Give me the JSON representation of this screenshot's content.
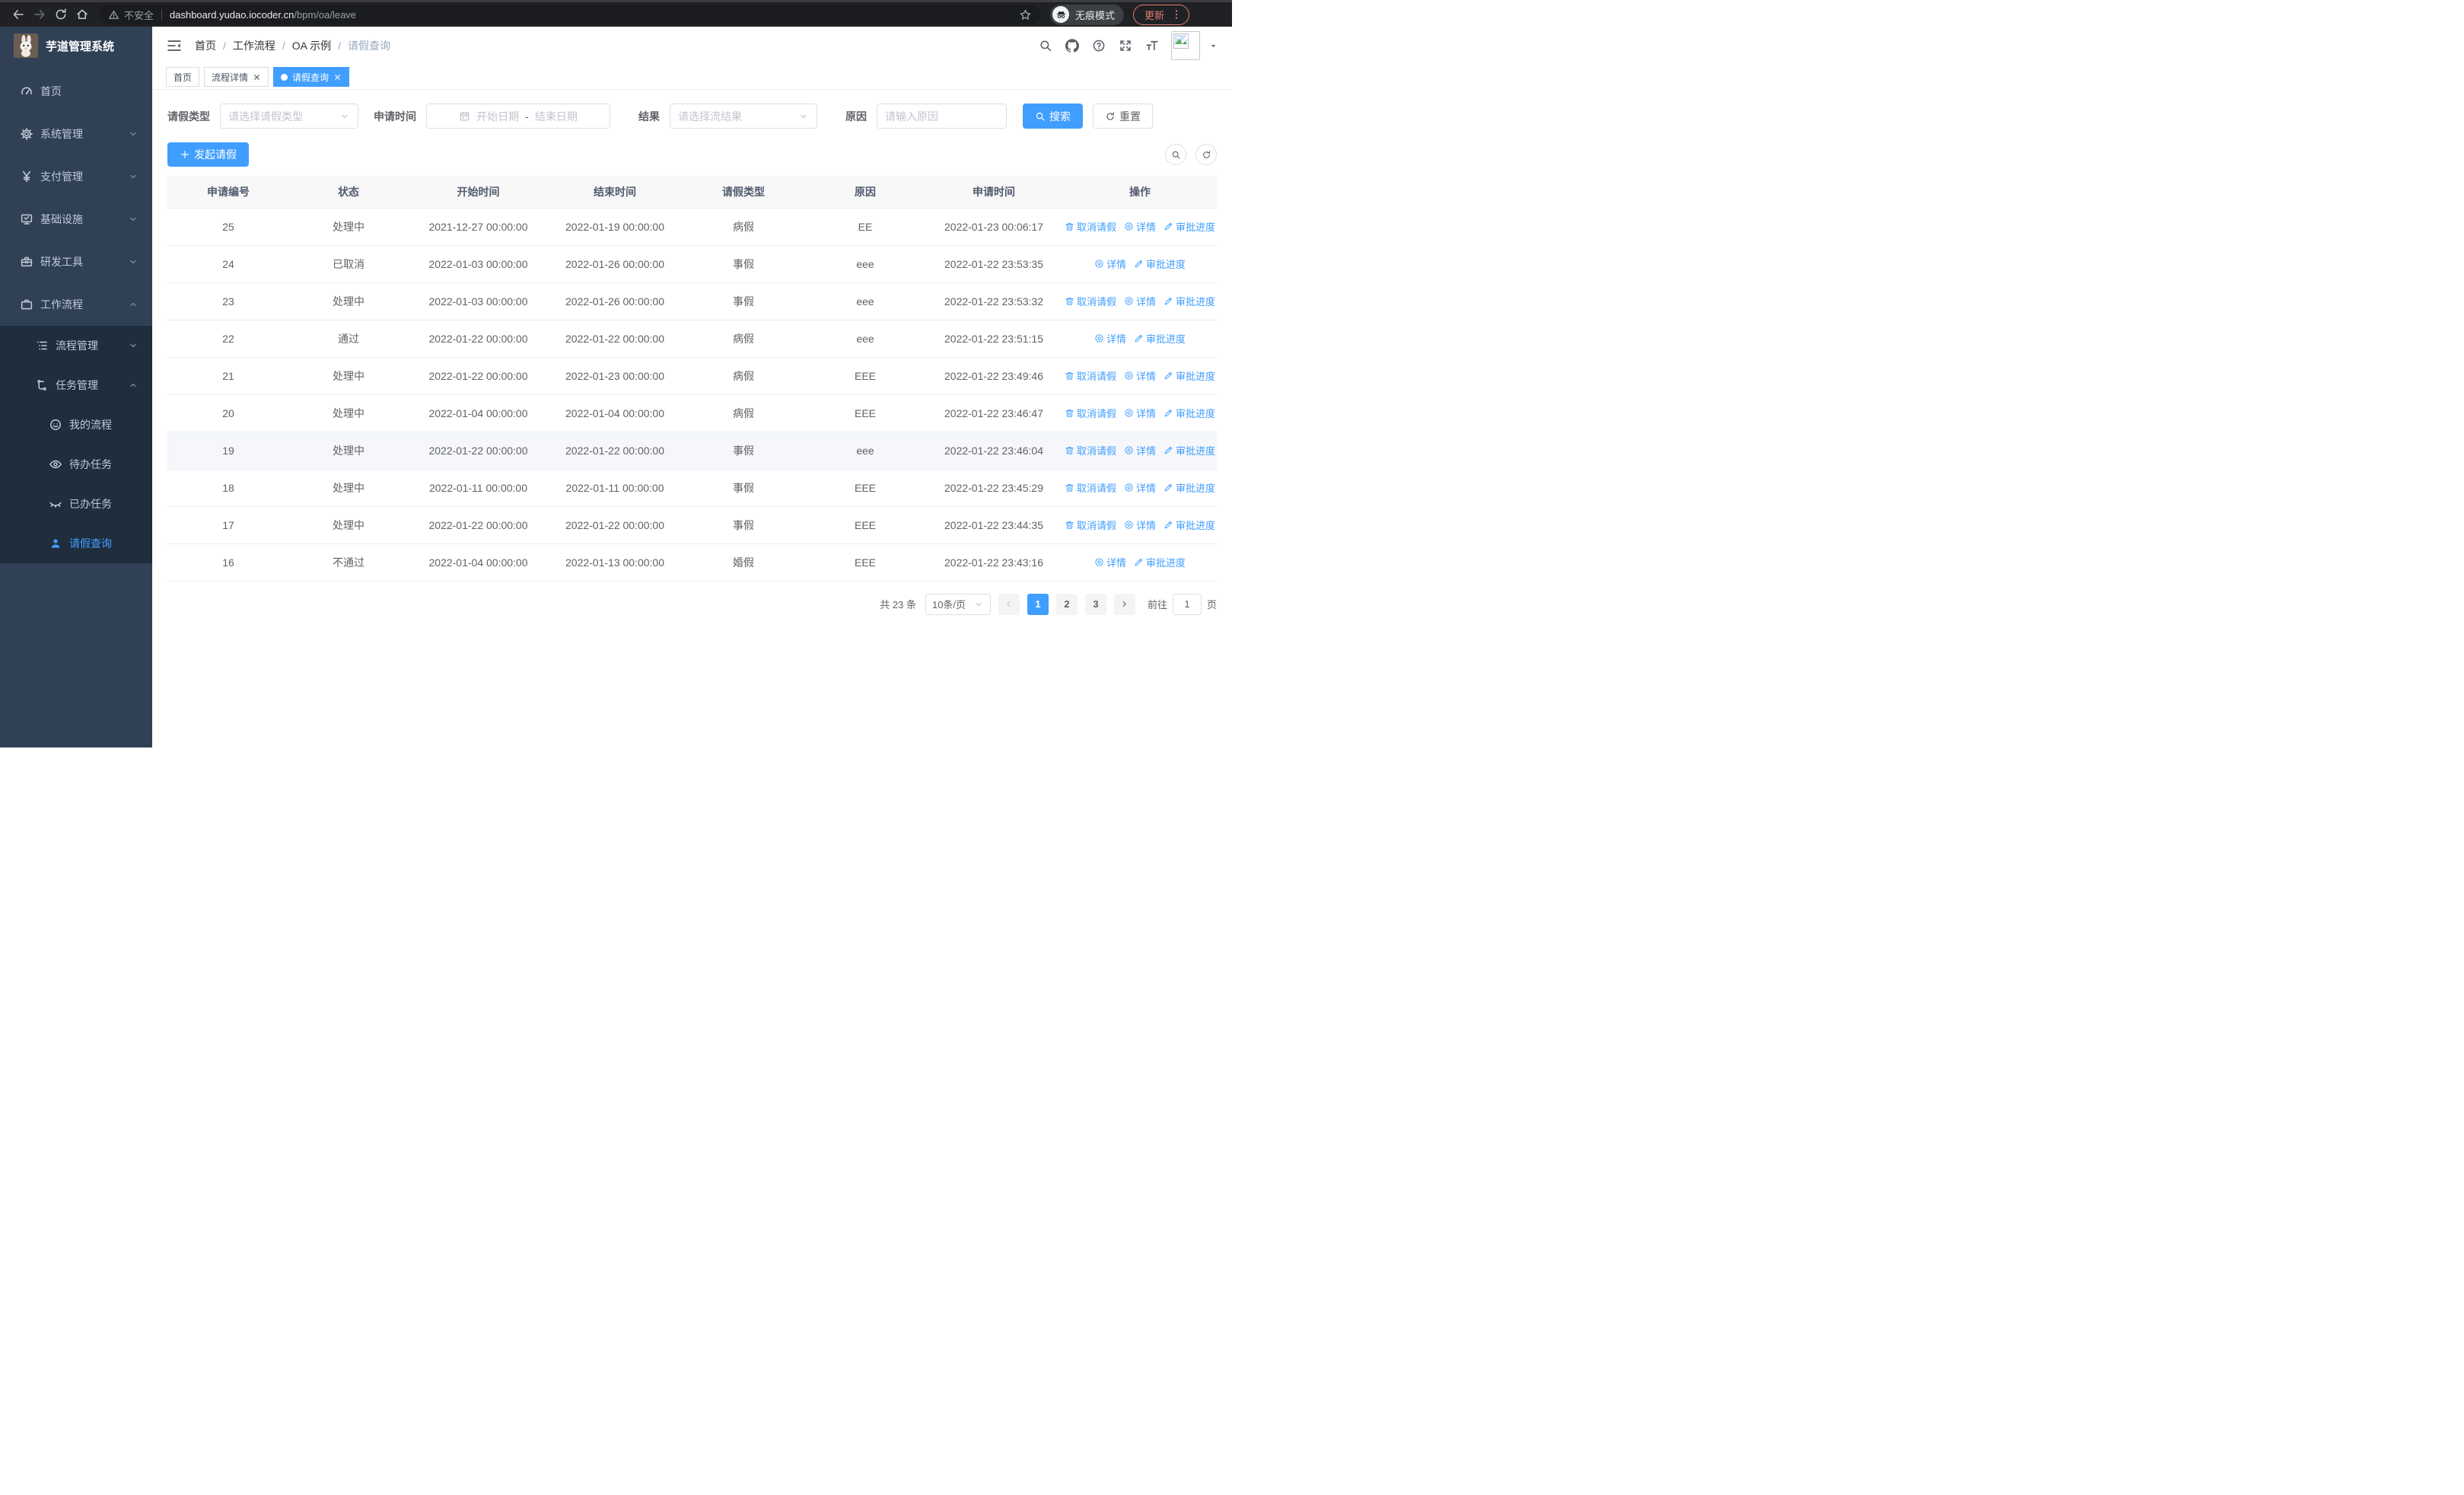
{
  "browser": {
    "security_label": "不安全",
    "url_host": "dashboard.yudao.iocoder.cn",
    "url_path": "/bpm/oa/leave",
    "incognito_label": "无痕模式",
    "update_label": "更新"
  },
  "sidebar": {
    "title": "芋道管理系统",
    "menu": [
      {
        "name": "home",
        "label": "首页",
        "icon": "gauge",
        "level": 0
      },
      {
        "name": "system",
        "label": "系统管理",
        "icon": "gear",
        "level": 0,
        "chevron": "down"
      },
      {
        "name": "payment",
        "label": "支付管理",
        "icon": "yen",
        "level": 0,
        "chevron": "down"
      },
      {
        "name": "infra",
        "label": "基础设施",
        "icon": "monitor",
        "level": 0,
        "chevron": "down"
      },
      {
        "name": "devtools",
        "label": "研发工具",
        "icon": "toolbox",
        "level": 0,
        "chevron": "down"
      },
      {
        "name": "workflow",
        "label": "工作流程",
        "icon": "briefcase",
        "level": 0,
        "chevron": "up"
      }
    ],
    "submenu": [
      {
        "name": "process-mgmt",
        "label": "流程管理",
        "icon": "tree",
        "level": 1,
        "chevron": "down"
      },
      {
        "name": "task-mgmt",
        "label": "任务管理",
        "icon": "flow",
        "level": 1,
        "chevron": "up"
      },
      {
        "name": "my-process",
        "label": "我的流程",
        "icon": "face",
        "level": 2
      },
      {
        "name": "todo-tasks",
        "label": "待办任务",
        "icon": "eye",
        "level": 2
      },
      {
        "name": "done-tasks",
        "label": "已办任务",
        "icon": "eye-closed",
        "level": 2
      },
      {
        "name": "leave-query",
        "label": "请假查询",
        "icon": "user",
        "level": 2,
        "active": true
      }
    ]
  },
  "navbar": {
    "breadcrumb": [
      "首页",
      "工作流程",
      "OA 示例",
      "请假查询"
    ]
  },
  "tabs": [
    {
      "label": "首页",
      "closable": false,
      "active": false
    },
    {
      "label": "流程详情",
      "closable": true,
      "active": false
    },
    {
      "label": "请假查询",
      "closable": true,
      "active": true
    }
  ],
  "filters": {
    "leave_type": {
      "label": "请假类型",
      "placeholder": "请选择请假类型"
    },
    "apply_time": {
      "label": "申请时间",
      "start_placeholder": "开始日期",
      "separator": "-",
      "end_placeholder": "结束日期"
    },
    "result": {
      "label": "结果",
      "placeholder": "请选择流结果"
    },
    "reason": {
      "label": "原因",
      "placeholder": "请输入原因"
    },
    "search_label": "搜索",
    "reset_label": "重置"
  },
  "toolbar": {
    "create_label": "发起请假"
  },
  "table": {
    "columns": [
      "申请编号",
      "状态",
      "开始时间",
      "结束时间",
      "请假类型",
      "原因",
      "申请时间",
      "操作"
    ],
    "action_labels": {
      "cancel": "取消请假",
      "detail": "详情",
      "progress": "审批进度"
    },
    "rows": [
      {
        "id": "25",
        "status": "处理中",
        "start": "2021-12-27 00:00:00",
        "end": "2022-01-19 00:00:00",
        "type": "病假",
        "reason": "EE",
        "apply_time": "2022-01-23 00:06:17",
        "actions": [
          "cancel",
          "detail",
          "progress"
        ],
        "highlight": false
      },
      {
        "id": "24",
        "status": "已取消",
        "start": "2022-01-03 00:00:00",
        "end": "2022-01-26 00:00:00",
        "type": "事假",
        "reason": "eee",
        "apply_time": "2022-01-22 23:53:35",
        "actions": [
          "detail",
          "progress"
        ],
        "highlight": false
      },
      {
        "id": "23",
        "status": "处理中",
        "start": "2022-01-03 00:00:00",
        "end": "2022-01-26 00:00:00",
        "type": "事假",
        "reason": "eee",
        "apply_time": "2022-01-22 23:53:32",
        "actions": [
          "cancel",
          "detail",
          "progress"
        ],
        "highlight": false
      },
      {
        "id": "22",
        "status": "通过",
        "start": "2022-01-22 00:00:00",
        "end": "2022-01-22 00:00:00",
        "type": "病假",
        "reason": "eee",
        "apply_time": "2022-01-22 23:51:15",
        "actions": [
          "detail",
          "progress"
        ],
        "highlight": false
      },
      {
        "id": "21",
        "status": "处理中",
        "start": "2022-01-22 00:00:00",
        "end": "2022-01-23 00:00:00",
        "type": "病假",
        "reason": "EEE",
        "apply_time": "2022-01-22 23:49:46",
        "actions": [
          "cancel",
          "detail",
          "progress"
        ],
        "highlight": false
      },
      {
        "id": "20",
        "status": "处理中",
        "start": "2022-01-04 00:00:00",
        "end": "2022-01-04 00:00:00",
        "type": "病假",
        "reason": "EEE",
        "apply_time": "2022-01-22 23:46:47",
        "actions": [
          "cancel",
          "detail",
          "progress"
        ],
        "highlight": false
      },
      {
        "id": "19",
        "status": "处理中",
        "start": "2022-01-22 00:00:00",
        "end": "2022-01-22 00:00:00",
        "type": "事假",
        "reason": "eee",
        "apply_time": "2022-01-22 23:46:04",
        "actions": [
          "cancel",
          "detail",
          "progress"
        ],
        "highlight": true
      },
      {
        "id": "18",
        "status": "处理中",
        "start": "2022-01-11 00:00:00",
        "end": "2022-01-11 00:00:00",
        "type": "事假",
        "reason": "EEE",
        "apply_time": "2022-01-22 23:45:29",
        "actions": [
          "cancel",
          "detail",
          "progress"
        ],
        "highlight": false
      },
      {
        "id": "17",
        "status": "处理中",
        "start": "2022-01-22 00:00:00",
        "end": "2022-01-22 00:00:00",
        "type": "事假",
        "reason": "EEE",
        "apply_time": "2022-01-22 23:44:35",
        "actions": [
          "cancel",
          "detail",
          "progress"
        ],
        "highlight": false
      },
      {
        "id": "16",
        "status": "不通过",
        "start": "2022-01-04 00:00:00",
        "end": "2022-01-13 00:00:00",
        "type": "婚假",
        "reason": "EEE",
        "apply_time": "2022-01-22 23:43:16",
        "actions": [
          "detail",
          "progress"
        ],
        "highlight": false
      }
    ]
  },
  "pagination": {
    "total_label": "共 23 条",
    "page_size": "10条/页",
    "pages": [
      "1",
      "2",
      "3"
    ],
    "active_page": "1",
    "goto_label": "前往",
    "goto_value": "1",
    "page_label": "页"
  },
  "colors": {
    "primary": "#409eff",
    "sidebar_bg": "#304156",
    "submenu_bg": "#1f2d3d",
    "sidebar_text": "#bfcbd9",
    "browser_bar_bg": "#202124",
    "update_accent": "#e07e72",
    "table_header_bg": "#f8f8f9",
    "row_hover_bg": "#f5f7fa",
    "border": "#ebeef5"
  }
}
